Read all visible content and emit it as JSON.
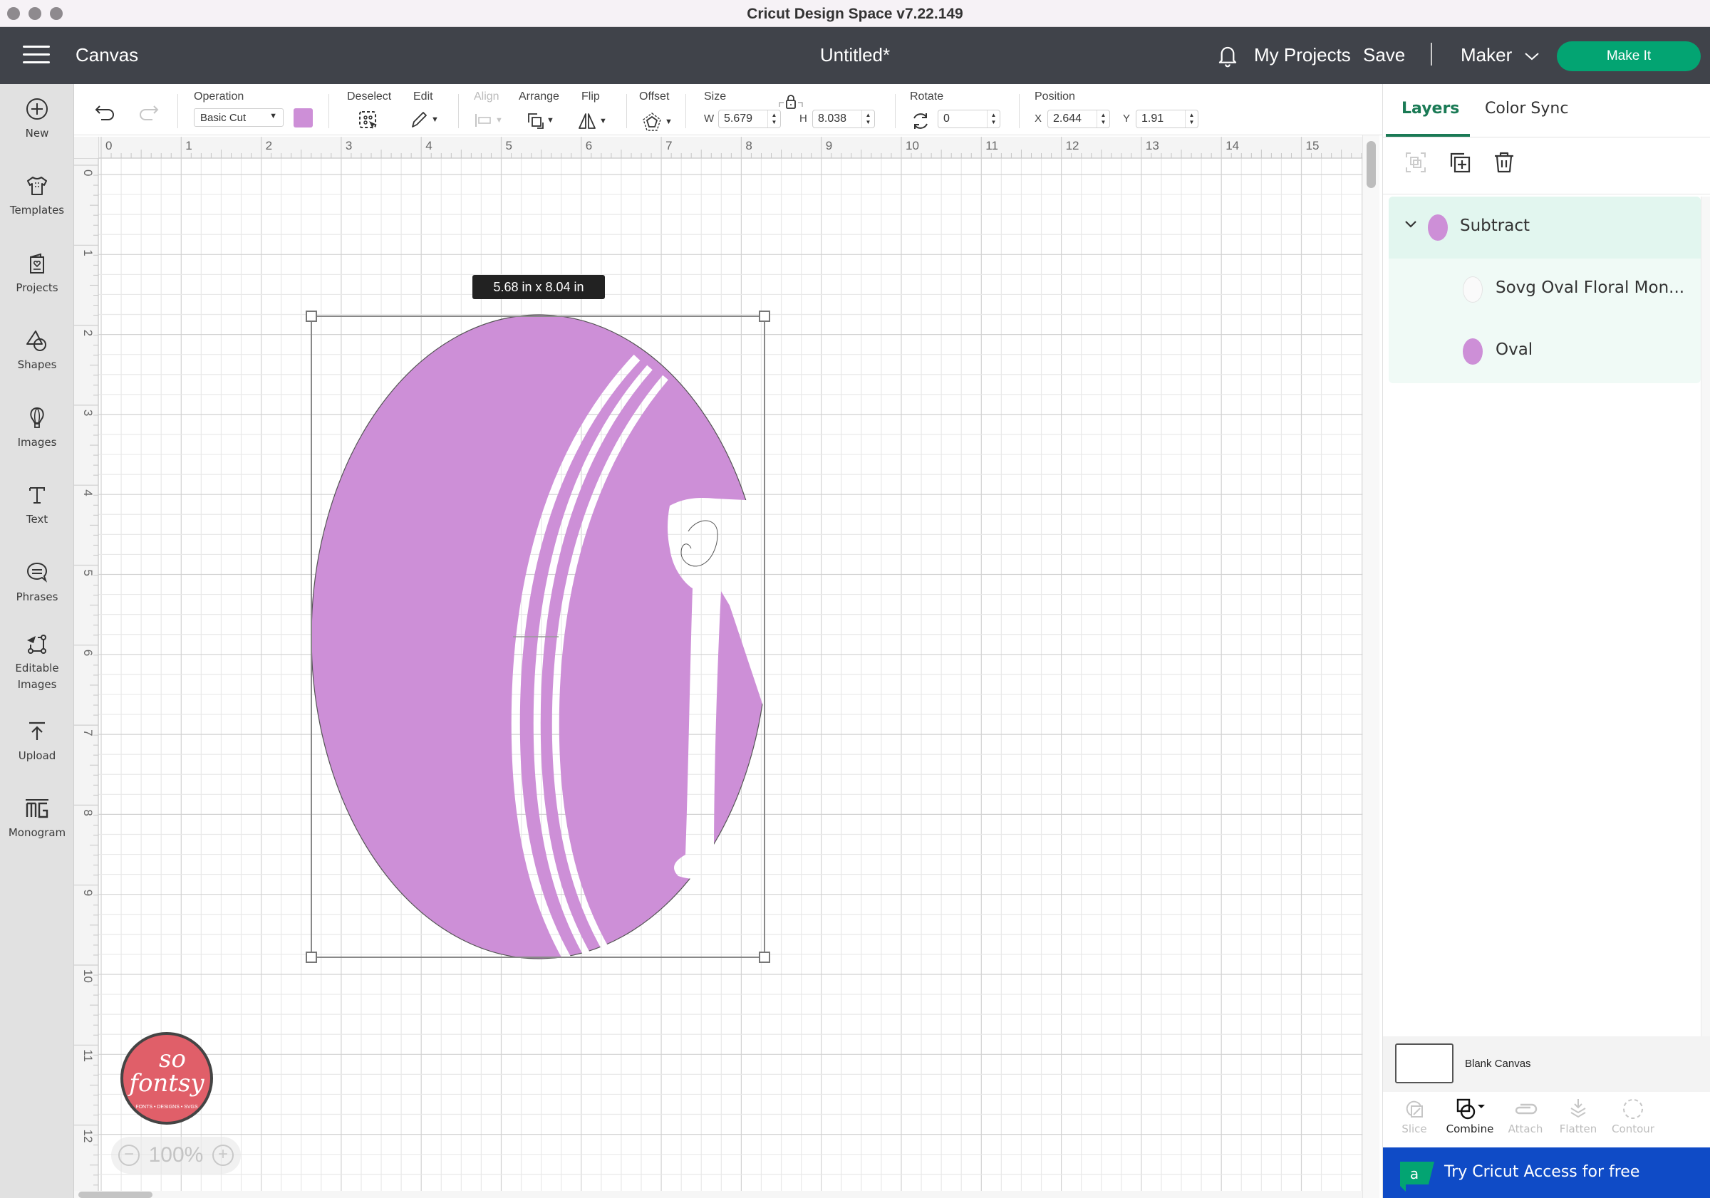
{
  "window": {
    "title": "Cricut Design Space  v7.22.149"
  },
  "header": {
    "section": "Canvas",
    "document_title": "Untitled*",
    "notifications_icon": "bell-icon",
    "my_projects": "My Projects",
    "save": "Save",
    "machine": "Maker",
    "make_it": "Make It"
  },
  "sidebar": {
    "items": [
      {
        "label": "New",
        "icon": "plus-circle-icon"
      },
      {
        "label": "Templates",
        "icon": "tshirt-icon"
      },
      {
        "label": "Projects",
        "icon": "projects-icon"
      },
      {
        "label": "Shapes",
        "icon": "shapes-icon"
      },
      {
        "label": "Images",
        "icon": "balloon-icon"
      },
      {
        "label": "Text",
        "icon": "text-icon"
      },
      {
        "label": "Phrases",
        "icon": "speech-bubble-icon"
      },
      {
        "label": "Editable Images",
        "icon": "editable-images-icon"
      },
      {
        "label": "Upload",
        "icon": "upload-icon"
      },
      {
        "label": "Monogram",
        "icon": "monogram-icon"
      }
    ]
  },
  "toolbar": {
    "operation_label": "Operation",
    "operation_value": "Basic Cut",
    "operation_color": "#cd8fd7",
    "deselect_label": "Deselect",
    "edit_label": "Edit",
    "align_label": "Align",
    "arrange_label": "Arrange",
    "flip_label": "Flip",
    "offset_label": "Offset",
    "size_label": "Size",
    "width_axis": "W",
    "width_value": "5.679",
    "height_axis": "H",
    "height_value": "8.038",
    "rotate_label": "Rotate",
    "rotate_value": "0",
    "position_label": "Position",
    "x_axis": "X",
    "x_value": "2.644",
    "y_axis": "Y",
    "y_value": "1.91"
  },
  "canvas": {
    "ruler_x": [
      "0",
      "1",
      "2",
      "3",
      "4",
      "5",
      "6",
      "7",
      "8",
      "9",
      "10",
      "11",
      "12",
      "13",
      "14",
      "15"
    ],
    "ruler_y": [
      "0",
      "1",
      "2",
      "3",
      "4",
      "5",
      "6",
      "7",
      "8",
      "9",
      "10",
      "11",
      "12"
    ],
    "dimension_badge": "5.68  in x 8.04  in",
    "design_fill": "#cd8fd7",
    "zoom_level": "100%",
    "watermark": {
      "line1": "so",
      "line2": "fontsy",
      "tagline": "FONTS • DESIGNS • SVGS"
    }
  },
  "right_panel": {
    "tabs": [
      {
        "label": "Layers",
        "active": true
      },
      {
        "label": "Color Sync",
        "active": false
      }
    ],
    "layers": [
      {
        "name": "Subtract",
        "type": "group",
        "expanded": true,
        "color": "#cd8fd7"
      },
      {
        "name": "Sovg Oval Floral Mon...",
        "type": "child",
        "color": "#ffffff"
      },
      {
        "name": "Oval",
        "type": "child",
        "color": "#cd8fd7"
      }
    ],
    "blank_canvas_label": "Blank Canvas",
    "operations": [
      {
        "label": "Slice",
        "enabled": false
      },
      {
        "label": "Combine",
        "enabled": true
      },
      {
        "label": "Attach",
        "enabled": false
      },
      {
        "label": "Flatten",
        "enabled": false
      },
      {
        "label": "Contour",
        "enabled": false
      }
    ],
    "access_banner": "Try Cricut Access for free",
    "access_logo": "a"
  },
  "colors": {
    "accent_green": "#03a472",
    "tab_green": "#1a7a55",
    "header_bg": "#40434a",
    "access_blue": "#0f4bc6"
  }
}
